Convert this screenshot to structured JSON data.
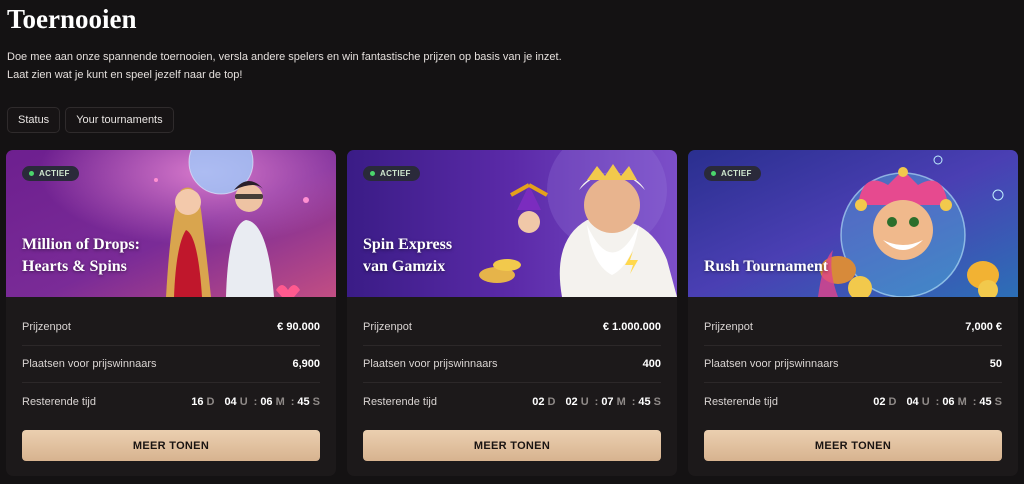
{
  "page": {
    "title": "Toernooien",
    "intro": "Doe mee aan onze spannende toernooien, versla andere spelers en win fantastische prijzen op basis van je inzet. Laat zien wat je kunt en speel jezelf naar de top!"
  },
  "filters": [
    {
      "label": "Status"
    },
    {
      "label": "Your tournaments"
    }
  ],
  "labels": {
    "prize_pool": "Prijzenpot",
    "winner_places": "Plaatsen voor prijswinnaars",
    "time_left": "Resterende tijd",
    "units": {
      "days": "D",
      "hours": "U",
      "minutes": "M",
      "seconds": "S",
      "separator": ":"
    },
    "more_button": "MEER TONEN"
  },
  "cards": [
    {
      "status": "ACTIEF",
      "title_line1": "Million of Drops:",
      "title_line2": "Hearts & Spins",
      "prize_pool": "€ 90.000",
      "winner_places": "6,900",
      "time": {
        "days": "16",
        "hours": "04",
        "minutes": "06",
        "seconds": "45"
      }
    },
    {
      "status": "ACTIEF",
      "title_line1": "Spin Express",
      "title_line2": "van Gamzix",
      "prize_pool": "€ 1.000.000",
      "winner_places": "400",
      "time": {
        "days": "02",
        "hours": "02",
        "minutes": "07",
        "seconds": "45"
      }
    },
    {
      "status": "ACTIEF",
      "title_line1": "Rush Tournament",
      "title_line2": "",
      "prize_pool": "7,000 €",
      "winner_places": "50",
      "time": {
        "days": "02",
        "hours": "04",
        "minutes": "06",
        "seconds": "45"
      }
    }
  ],
  "colors": {
    "background": "#141213",
    "card": "#1c191a",
    "button_gradient_top": "#ebcfb0",
    "button_gradient_bottom": "#d7b38f",
    "active_dot": "#4bd66c"
  }
}
